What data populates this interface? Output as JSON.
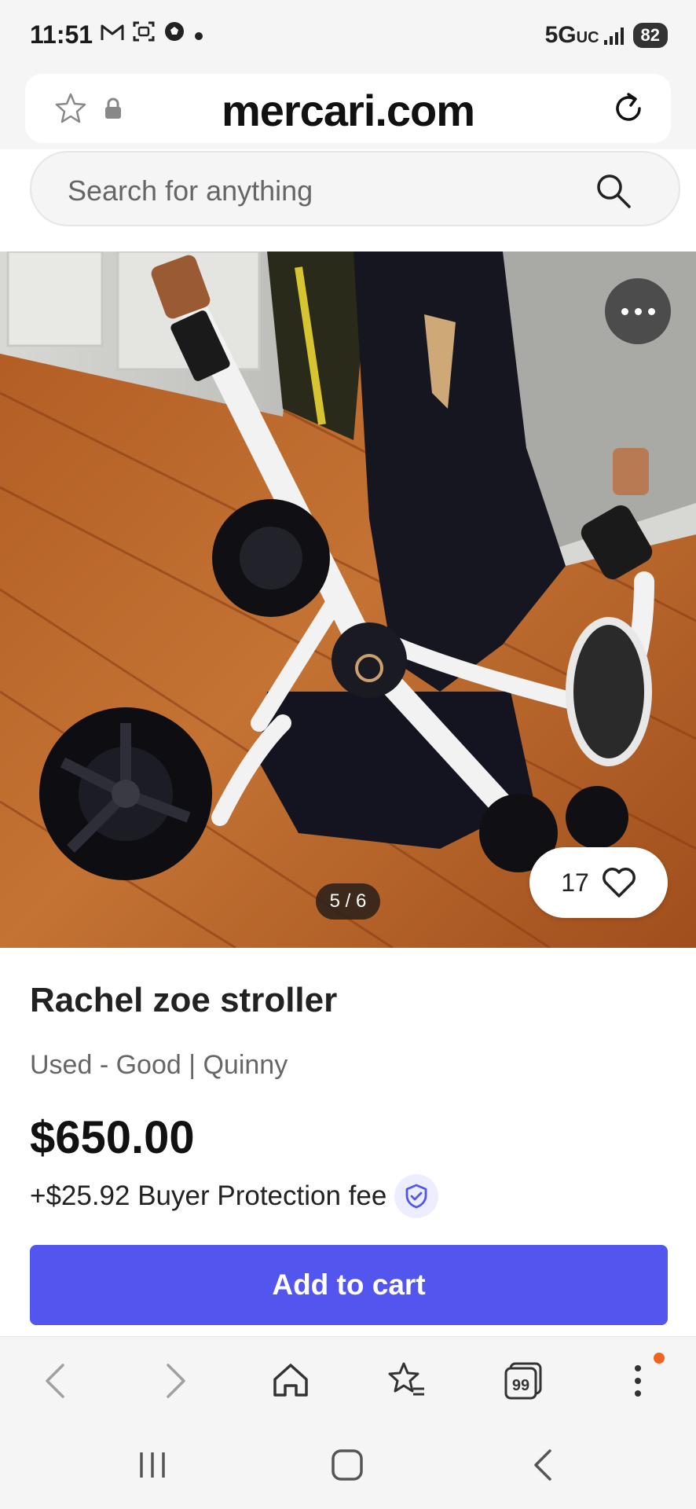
{
  "status_bar": {
    "time": "11:51",
    "network": "5G",
    "network_sub": "UC",
    "battery": "82"
  },
  "browser": {
    "url": "mercari.com"
  },
  "search": {
    "placeholder": "Search for anything"
  },
  "gallery": {
    "counter": "5 / 6",
    "like_count": "17"
  },
  "listing": {
    "title": "Rachel zoe stroller",
    "condition": "Used - Good | Quinny",
    "price": "$650.00",
    "fee": "+$25.92 Buyer Protection fee",
    "add_to_cart": "Add to cart"
  },
  "colors": {
    "accent": "#5356ee",
    "notification": "#f06420"
  },
  "icons": {
    "status_left": [
      "gmail-icon",
      "screen-capture-icon",
      "soccer-ball-icon",
      "dot-icon"
    ],
    "browser_bar": [
      "back-icon",
      "forward-icon",
      "home-icon",
      "bookmarks-icon",
      "tabs-icon",
      "menu-icon"
    ],
    "system_nav": [
      "recents-icon",
      "home-nav-icon",
      "back-nav-icon"
    ]
  },
  "tabs_count": "99"
}
